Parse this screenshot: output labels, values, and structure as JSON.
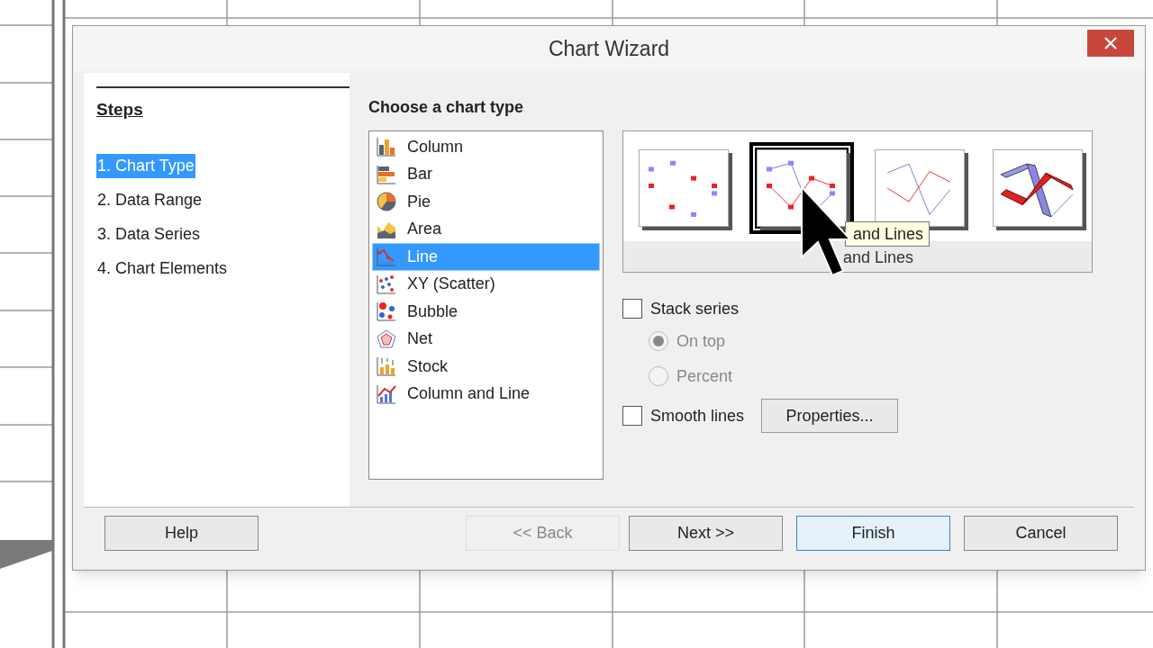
{
  "window": {
    "title": "Chart Wizard"
  },
  "steps": {
    "heading": "Steps",
    "items": [
      {
        "label": "1. Chart Type",
        "selected": true
      },
      {
        "label": "2. Data Range",
        "selected": false
      },
      {
        "label": "3. Data Series",
        "selected": false
      },
      {
        "label": "4. Chart Elements",
        "selected": false
      }
    ]
  },
  "chart_types": {
    "heading": "Choose a chart type",
    "items": [
      {
        "label": "Column",
        "kind": "column",
        "selected": false
      },
      {
        "label": "Bar",
        "kind": "bar",
        "selected": false
      },
      {
        "label": "Pie",
        "kind": "pie",
        "selected": false
      },
      {
        "label": "Area",
        "kind": "area",
        "selected": false
      },
      {
        "label": "Line",
        "kind": "line",
        "selected": true
      },
      {
        "label": "XY (Scatter)",
        "kind": "scatter",
        "selected": false
      },
      {
        "label": "Bubble",
        "kind": "bubble",
        "selected": false
      },
      {
        "label": "Net",
        "kind": "net",
        "selected": false
      },
      {
        "label": "Stock",
        "kind": "stock",
        "selected": false
      },
      {
        "label": "Column and Line",
        "kind": "column_line",
        "selected": false
      }
    ]
  },
  "variants": {
    "items": [
      {
        "kind": "points",
        "selected": false
      },
      {
        "kind": "points_lines",
        "selected": true
      },
      {
        "kind": "lines",
        "selected": false
      },
      {
        "kind": "lines_3d",
        "selected": false
      }
    ],
    "label": "and Lines",
    "tooltip": "and Lines"
  },
  "stack_series": {
    "label": "Stack series",
    "checked": false
  },
  "stack_options": [
    {
      "label": "On top",
      "selected": true,
      "disabled": true
    },
    {
      "label": "Percent",
      "selected": false,
      "disabled": true
    }
  ],
  "smooth_lines": {
    "label": "Smooth lines",
    "checked": false
  },
  "properties_button": "Properties...",
  "buttons": [
    {
      "label": "Help",
      "kind": "help",
      "disabled": false,
      "default": false
    },
    {
      "label": "<< Back",
      "kind": "back",
      "disabled": true,
      "default": false
    },
    {
      "label": "Next >>",
      "kind": "next",
      "disabled": false,
      "default": false
    },
    {
      "label": "Finish",
      "kind": "finish",
      "disabled": false,
      "default": true
    },
    {
      "label": "Cancel",
      "kind": "cancel",
      "disabled": false,
      "default": false
    }
  ]
}
